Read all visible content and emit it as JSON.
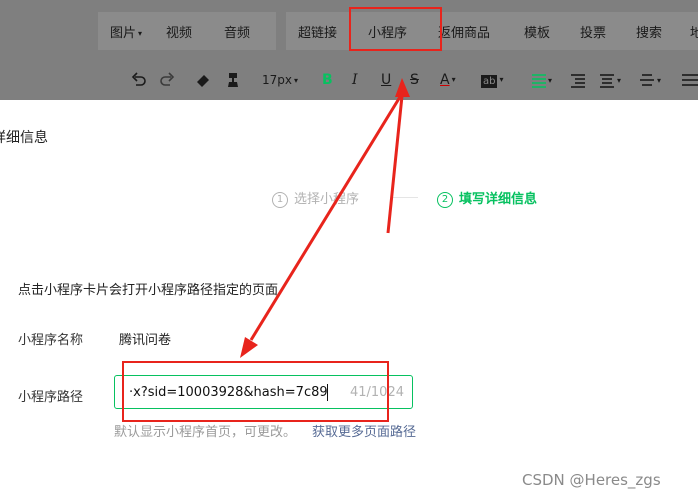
{
  "toolbar": {
    "tabs": {
      "image": "图片",
      "video": "视频",
      "audio": "音频",
      "hyperlink": "超链接",
      "mini_program": "小程序",
      "rebate_goods": "返佣商品",
      "template": "模板",
      "vote": "投票",
      "search": "搜索",
      "more": "地"
    },
    "font_size": "17px"
  },
  "page": {
    "heading": "详细信息",
    "steps": [
      {
        "num": "1",
        "label": "选择小程序"
      },
      {
        "num": "2",
        "label": "填写详细信息"
      }
    ],
    "hint": "点击小程序卡片会打开小程序路径指定的页面",
    "name_label": "小程序名称",
    "name_value": "腾讯问卷",
    "path_label": "小程序路径",
    "path_value": "·x?sid=10003928&hash=7c89",
    "counter": "41/1024",
    "help_text": "默认显示小程序首页，可更改。",
    "help_link": "获取更多页面路径"
  },
  "watermark": "CSDN @Heres_zgs",
  "colors": {
    "accent": "#07c160",
    "link": "#576b95",
    "annotation": "#e8241c"
  }
}
